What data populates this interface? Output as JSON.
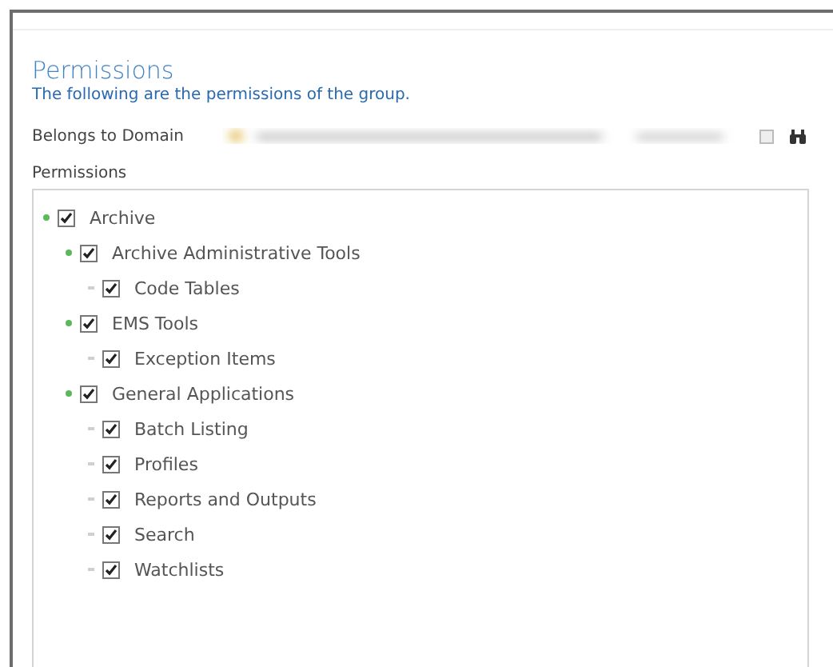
{
  "header": {
    "title": "Permissions",
    "subtitle": "The following are the permissions of the group."
  },
  "domain": {
    "label": "Belongs to Domain"
  },
  "permissions": {
    "label": "Permissions",
    "tree": [
      {
        "label": "Archive",
        "checked": true,
        "children": [
          {
            "label": "Archive Administrative Tools",
            "checked": true,
            "children": [
              {
                "label": "Code Tables",
                "checked": true
              }
            ]
          },
          {
            "label": "EMS Tools",
            "checked": true,
            "children": [
              {
                "label": "Exception Items",
                "checked": true
              }
            ]
          },
          {
            "label": "General Applications",
            "checked": true,
            "children": [
              {
                "label": "Batch Listing",
                "checked": true
              },
              {
                "label": "Profiles",
                "checked": true
              },
              {
                "label": "Reports and Outputs",
                "checked": true
              },
              {
                "label": "Search",
                "checked": true
              },
              {
                "label": "Watchlists",
                "checked": true
              }
            ]
          }
        ]
      }
    ]
  }
}
